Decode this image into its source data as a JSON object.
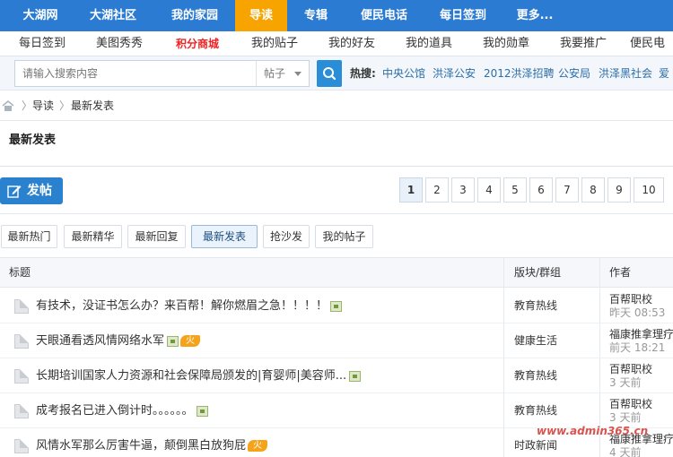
{
  "top_nav": [
    "大湖网",
    "大湖社区",
    "我的家园",
    "导读",
    "专辑",
    "便民电话",
    "每日签到",
    "更多..."
  ],
  "top_nav_active": 3,
  "sub_nav": [
    "每日签到",
    "美图秀秀",
    "积分商城",
    "我的贴子",
    "我的好友",
    "我的道具",
    "我的勋章",
    "我要推广",
    "便民电"
  ],
  "search": {
    "placeholder": "请输入搜索内容",
    "type_value": "帖子",
    "hot_label": "热搜:",
    "hot_links": [
      "中央公馆",
      "洪泽公安",
      "2012洪泽招聘",
      "公安局",
      "洪泽黑社会",
      "爱"
    ]
  },
  "breadcrumb": [
    "导读",
    "最新发表"
  ],
  "page_title": "最新发表",
  "post_button": "发帖",
  "pagination": [
    "1",
    "2",
    "3",
    "4",
    "5",
    "6",
    "7",
    "8",
    "9",
    "10"
  ],
  "pagination_current": "1",
  "filter_tabs": [
    "最新热门",
    "最新精华",
    "最新回复",
    "最新发表",
    "抢沙发",
    "我的帖子"
  ],
  "filter_active": "最新发表",
  "table": {
    "headers": [
      "标题",
      "版块/群组",
      "作者"
    ],
    "rows": [
      {
        "title": "有技术，没证书怎么办？来百帮！解你燃眉之急！！！！",
        "has_image": true,
        "hot": false,
        "board": "教育热线",
        "author": "百帮职校",
        "time": "昨天 08:53"
      },
      {
        "title": "天眼通看透风情网络水军",
        "has_image": true,
        "hot": true,
        "hot_label": "火",
        "board": "健康生活",
        "author": "福康推拿理疗",
        "time": "前天 18:21"
      },
      {
        "title": "长期培训国家人力资源和社会保障局颁发的|育婴师|美容师...",
        "has_image": true,
        "hot": false,
        "board": "教育热线",
        "author": "百帮职校",
        "time": "3 天前"
      },
      {
        "title": "成考报名已进入倒计时。。。。。。",
        "has_image": true,
        "hot": false,
        "board": "教育热线",
        "author": "百帮职校",
        "time": "3 天前"
      },
      {
        "title": "风情水军那么厉害牛逼，颠倒黑白放狗屁",
        "has_image": false,
        "hot": true,
        "hot_label": "火",
        "board": "时政新闻",
        "author": "福康推拿理疗",
        "time": "4 天前"
      }
    ]
  },
  "watermark": "www.admin365.cn",
  "colors": {
    "nav_blue": "#2b7bd3",
    "nav_active": "#f7a400",
    "accent_red": "#e22222",
    "link_blue": "#2b6ea8"
  }
}
